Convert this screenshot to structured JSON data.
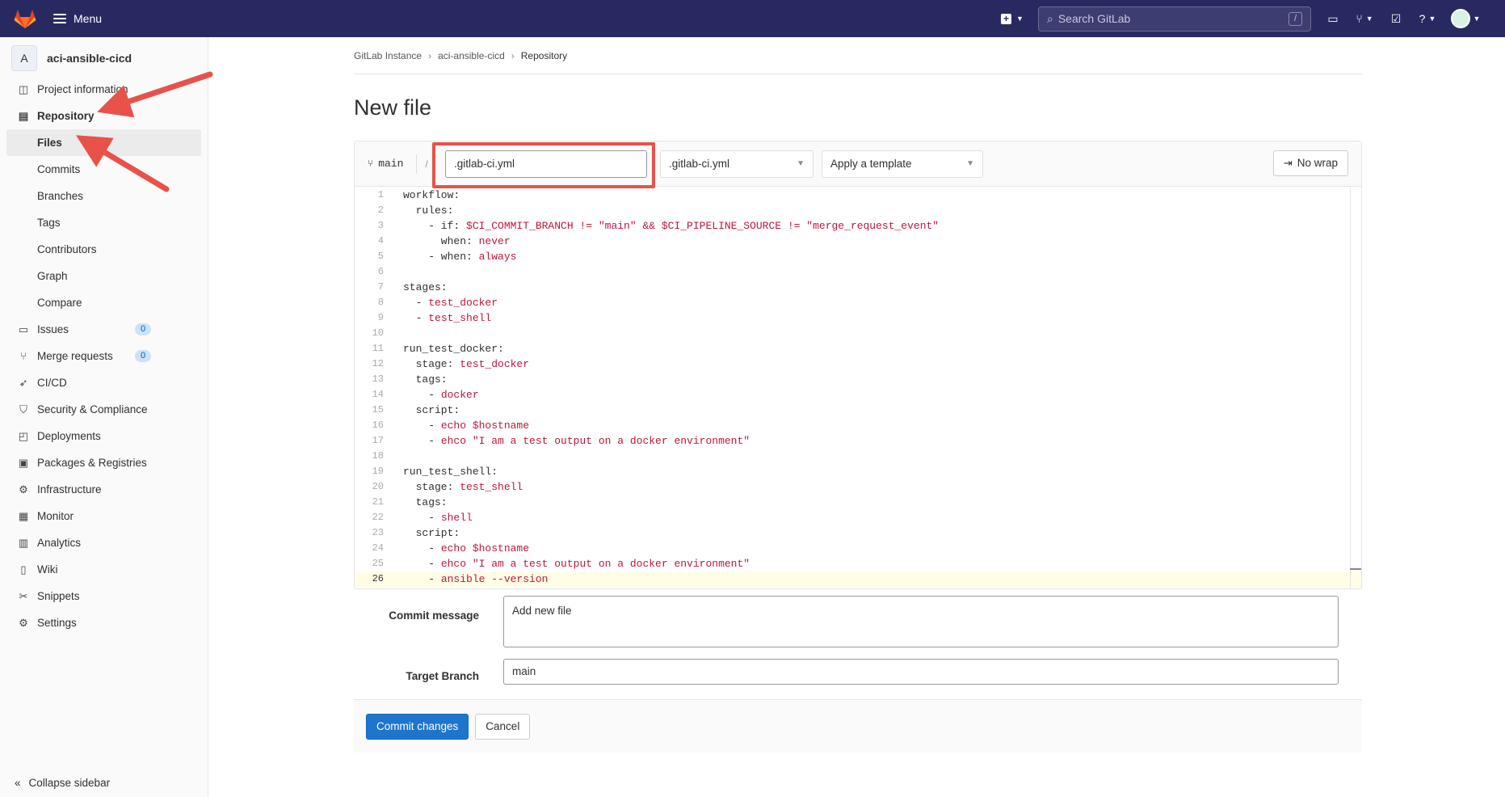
{
  "topbar": {
    "menu_label": "Menu",
    "search_placeholder": "Search GitLab",
    "search_shortcut": "/",
    "icons": [
      "plus-icon",
      "issues-icon",
      "merge-request-icon",
      "todo-icon",
      "help-icon",
      "avatar"
    ]
  },
  "sidebar": {
    "project_initial": "A",
    "project_name": "aci-ansible-cicd",
    "items": [
      {
        "label": "Project information",
        "icon": "info-icon"
      },
      {
        "label": "Repository",
        "icon": "document-icon"
      },
      {
        "label": "Issues",
        "icon": "issues-icon",
        "badge": "0"
      },
      {
        "label": "Merge requests",
        "icon": "merge-request-icon",
        "badge": "0"
      },
      {
        "label": "CI/CD",
        "icon": "rocket-icon"
      },
      {
        "label": "Security & Compliance",
        "icon": "shield-icon"
      },
      {
        "label": "Deployments",
        "icon": "deployments-icon"
      },
      {
        "label": "Packages & Registries",
        "icon": "package-icon"
      },
      {
        "label": "Infrastructure",
        "icon": "cloud-gear-icon"
      },
      {
        "label": "Monitor",
        "icon": "monitor-icon"
      },
      {
        "label": "Analytics",
        "icon": "chart-icon"
      },
      {
        "label": "Wiki",
        "icon": "book-icon"
      },
      {
        "label": "Snippets",
        "icon": "scissors-icon"
      },
      {
        "label": "Settings",
        "icon": "gear-icon"
      }
    ],
    "repo_sub": [
      "Files",
      "Commits",
      "Branches",
      "Tags",
      "Contributors",
      "Graph",
      "Compare"
    ],
    "collapse_label": "Collapse sidebar"
  },
  "breadcrumb": [
    "GitLab Instance",
    "aci-ansible-cicd",
    "Repository"
  ],
  "page_title": "New file",
  "editor": {
    "branch": "main",
    "file_name": ".gitlab-ci.yml",
    "template_type": ".gitlab-ci.yml",
    "template_placeholder": "Apply a template",
    "no_wrap_label": "No wrap",
    "lines": [
      "workflow:",
      "  rules:",
      "    - if: $CI_COMMIT_BRANCH != \"main\" && $CI_PIPELINE_SOURCE != \"merge_request_event\"",
      "      when: never",
      "    - when: always",
      "",
      "stages:",
      "  - test_docker",
      "  - test_shell",
      "",
      "run_test_docker:",
      "  stage: test_docker",
      "  tags:",
      "    - docker",
      "  script:",
      "    - echo $hostname",
      "    - ehco \"I am a test output on a docker environment\"",
      "",
      "run_test_shell:",
      "  stage: test_shell",
      "  tags:",
      "    - shell",
      "  script:",
      "    - echo $hostname",
      "    - ehco \"I am a test output on a docker environment\"",
      "    - ansible --version"
    ],
    "current_line": 26
  },
  "commit": {
    "message_label": "Commit message",
    "message_value": "Add new file",
    "branch_label": "Target Branch",
    "branch_value": "main",
    "commit_button": "Commit changes",
    "cancel_button": "Cancel"
  },
  "colors": {
    "topbar": "#292961",
    "primary": "#1f75cb",
    "annotation": "#e8524a"
  }
}
